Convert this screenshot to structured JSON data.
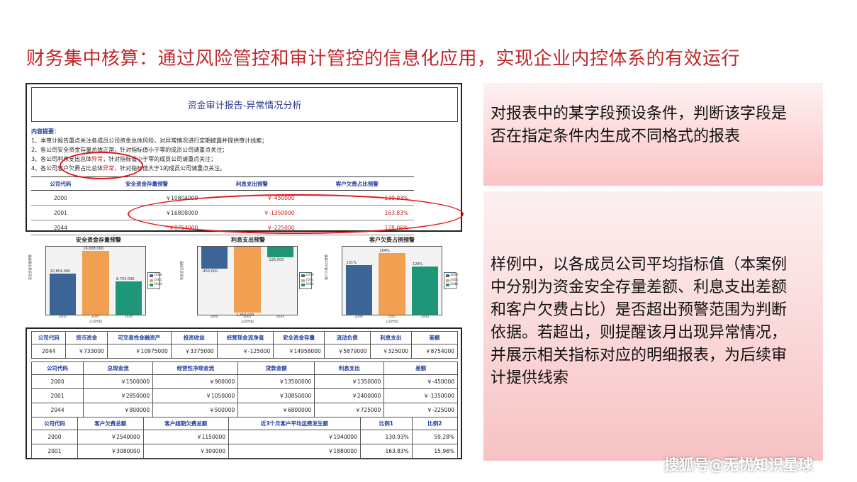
{
  "title": "财务集中核算：通过风险管控和审计管控的信息化应用，实现企业内控体系的有效运行",
  "report": {
    "heading": "资金审计报告-异常情况分析",
    "summary_label": "内容提要：",
    "lines": [
      "1、本审计报告重点关注各成员公司资金总体风险，对异常情况进行定期披露并提供审计线索；",
      "2、各公司安全资金存量总体正常，针对指标值小于零的成员公司请重点关注；",
      "3、各公司利息支出总体",
      "异常",
      "，针对指标值小于零的成员公司请重点关注；",
      "4、各公司客户欠费占比总体",
      "异常",
      "，针对指标值大于1的成员公司请重点关注。"
    ],
    "table": {
      "headers": [
        "公司代码",
        "安全资金存量预警",
        "利息支出预警",
        "客户欠费占比预警"
      ],
      "rows": [
        [
          "2000",
          "￥10804000",
          "￥-450000",
          "130.93%"
        ],
        [
          "2001",
          "￥16808000",
          "￥-1350000",
          "163.83%"
        ],
        [
          "2044",
          "￥8754000",
          "￥-225000",
          "128.06%"
        ]
      ]
    }
  },
  "chart_data": [
    {
      "type": "bar",
      "title": "安全资金存量预警",
      "categories": [
        "2000",
        "2001",
        "2044"
      ],
      "values": [
        10804000,
        16808000,
        8754000
      ],
      "labels": [
        "10,804,000",
        "16,808,000",
        "8,754,000"
      ],
      "xlabel": "公司代码",
      "ylabel": "安全资金存量预警",
      "ylim": [
        0,
        18000000
      ],
      "colors": [
        "#3c6496",
        "#f0a050",
        "#1e9678"
      ],
      "legend": "right"
    },
    {
      "type": "bar",
      "title": "利息支出预警",
      "categories": [
        "2000",
        "2001",
        "2044"
      ],
      "values": [
        -450000,
        -1350000,
        -225000
      ],
      "labels": [
        "-450,000",
        "-1,350,000",
        "-225,000"
      ],
      "xlabel": "公司代码",
      "ylabel": "利息支出预警",
      "ylim": [
        -1400000,
        0
      ],
      "colors": [
        "#3c6496",
        "#f0a050",
        "#1e9678"
      ],
      "legend": "right"
    },
    {
      "type": "bar",
      "title": "客户欠费占例预警",
      "categories": [
        "2000",
        "2001",
        "2044"
      ],
      "values": [
        130.93,
        163.83,
        128.06
      ],
      "labels": [
        "131%",
        "164%",
        "128%"
      ],
      "xlabel": "公司代码",
      "ylabel": "客户欠费占比预警",
      "ylim": [
        0,
        180
      ],
      "colors": [
        "#3c6496",
        "#f0a050",
        "#1e9678"
      ],
      "legend": "right"
    }
  ],
  "grid": {
    "t1": {
      "headers": [
        "公司代码",
        "货币资金",
        "可交易性金融资产",
        "投资收益",
        "经营现金流净值",
        "安全资金存量",
        "流动负债",
        "利息支出",
        "差额"
      ],
      "rows": [
        [
          "2044",
          "￥733000",
          "￥10975000",
          "￥3375000",
          "￥-125000",
          "￥14958000",
          "￥5879000",
          "￥325000",
          "￥8754000"
        ]
      ]
    },
    "t2": {
      "headers": [
        "公司代码",
        "总现金流",
        "经营性净现金流",
        "贷款金额",
        "利息支出",
        "差额"
      ],
      "rows": [
        [
          "2000",
          "￥1500000",
          "￥900000",
          "￥13500000",
          "￥1350000",
          "￥-450000"
        ],
        [
          "2001",
          "￥2850000",
          "￥1050000",
          "￥30850000",
          "￥2400000",
          "￥-1350000"
        ],
        [
          "2044",
          "￥800000",
          "￥500000",
          "￥6800000",
          "￥725000",
          "￥-225000"
        ]
      ]
    },
    "t3": {
      "headers": [
        "公司代码",
        "客户欠费总额",
        "客户超期欠费总额",
        "近3个月客户平均运费发生额",
        "比例1",
        "比例2"
      ],
      "rows": [
        [
          "2000",
          "￥2540000",
          "￥1150000",
          "￥1940000",
          "130.93%",
          "59.28%"
        ],
        [
          "2001",
          "￥3080000",
          "￥300000",
          "￥1880000",
          "163.83%",
          "15.96%"
        ]
      ]
    }
  },
  "panel1": {
    "text": "对报表中的某字段预设条件，判断该字段是否在指定条件内生成不同格式的报表"
  },
  "panel2": {
    "text": "样例中，以各成员公司平均指标值（本案例中分别为资金安全存量差额、利息支出差额和客户欠费占比）是否超出预警范围为判断依据。若超出，则提醒该月出现异常情况，并展示相关指标对应的明细报表，为后续审计提供线索"
  },
  "watermark": "搜狐号@无忧知识星球",
  "colors": {
    "title": "#c0282a",
    "highlight": "#e0161a",
    "header_blue": "#1f3c9c"
  }
}
